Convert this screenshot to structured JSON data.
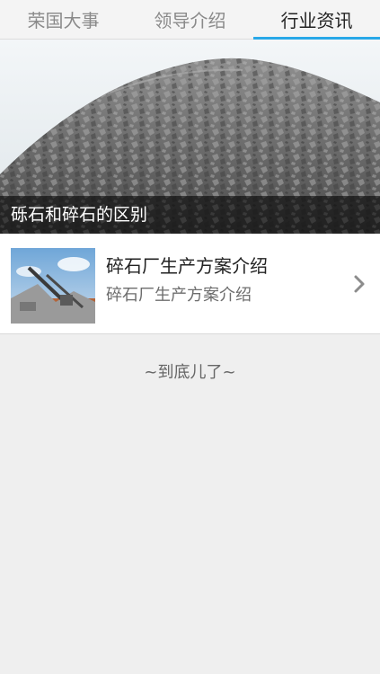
{
  "tabs": [
    {
      "label": "荣国大事",
      "active": false
    },
    {
      "label": "领导介绍",
      "active": false
    },
    {
      "label": "行业资讯",
      "active": true
    }
  ],
  "hero": {
    "caption": "砾石和碎石的区别"
  },
  "list": [
    {
      "title": "碎石厂生产方案介绍",
      "subtitle": "碎石厂生产方案介绍"
    }
  ],
  "footer": {
    "end_note": "~到底儿了~"
  },
  "colors": {
    "accent": "#29a8e8",
    "background": "#efefef"
  }
}
